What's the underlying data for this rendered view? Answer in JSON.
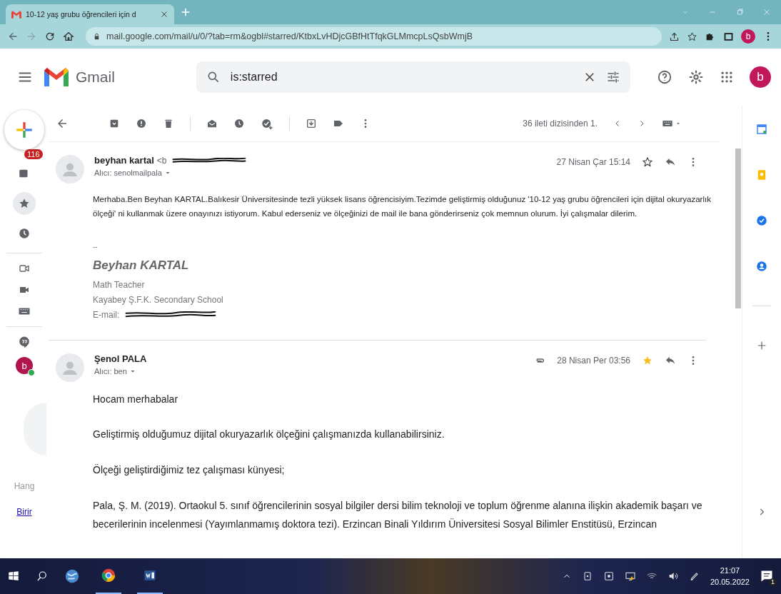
{
  "browser": {
    "tab_title": "10-12 yaş grubu öğrencileri için d",
    "url": "mail.google.com/mail/u/0/?tab=rm&ogbl#starred/KtbxLvHDjcGBfHtTfqkGLMmcpLsQsbWmjB",
    "profile": "b"
  },
  "gmail": {
    "logo_text": "Gmail",
    "search_value": "is:starred",
    "account": "b"
  },
  "toolbar": {
    "count": "36 ileti dizisinden 1."
  },
  "left_rail": {
    "inbox_badge": "116",
    "nav": [
      {
        "kind": "inbox",
        "selected": false
      },
      {
        "kind": "starred",
        "selected": true
      },
      {
        "kind": "snoozed",
        "selected": false
      }
    ],
    "chat_avatar": "b",
    "hangouts_text": "Hang",
    "link_text": "Birir"
  },
  "messages": [
    {
      "sender": "beyhan kartal",
      "sender_email": "<b",
      "recipient": "Alıcı: senolmailpala",
      "date": "27 Nisan Çar 15:14",
      "starred": false,
      "attachment": false,
      "kind": "compact",
      "paragraphs": [
        "Merhaba.Ben Beyhan KARTAL.Balıkesir Üniversitesinde tezli yüksek lisans öğrencisiyim.Tezimde geliştirmiş olduğunuz '10-12 yaş grubu öğrencileri için dijital okuryazarlık ölçeği' ni kullanmak üzere onayınızı istiyorum. Kabul ederseniz ve ölçeğinizi de mail ile bana gönderirseniz çok memnun olurum. İyi çalışmalar dilerim."
      ],
      "signature": {
        "separator": "--",
        "name": "Beyhan KARTAL",
        "lines": [
          "Math Teacher",
          "Kayabey Ş.F.K. Secondary School"
        ],
        "email_label": "E-mail:"
      }
    },
    {
      "sender": "Şenol PALA",
      "recipient": "Alıcı: ben",
      "date": "28 Nisan Per 03:56",
      "starred": true,
      "attachment": true,
      "kind": "regular",
      "paragraphs": [
        "Hocam merhabalar",
        "Geliştirmiş olduğumuz dijital okuryazarlık ölçeğini çalışmanızda kullanabilirsiniz.",
        "Ölçeği geliştirdiğimiz tez çalışması künyesi;",
        "Pala, Ş. M. (2019). Ortaokul 5. sınıf öğrencilerinin sosyal bilgiler dersi bilim teknoloji ve toplum öğrenme alanına ilişkin akademik başarı ve becerilerinin incelenmesi (Yayımlanmamış doktora tezi). Erzincan Binali Yıldırım Üniversitesi Sosyal Bilimler Enstitüsü, Erzincan"
      ]
    }
  ],
  "taskbar": {
    "time": "21:07",
    "date": "20.05.2022",
    "notification_count": "1"
  }
}
